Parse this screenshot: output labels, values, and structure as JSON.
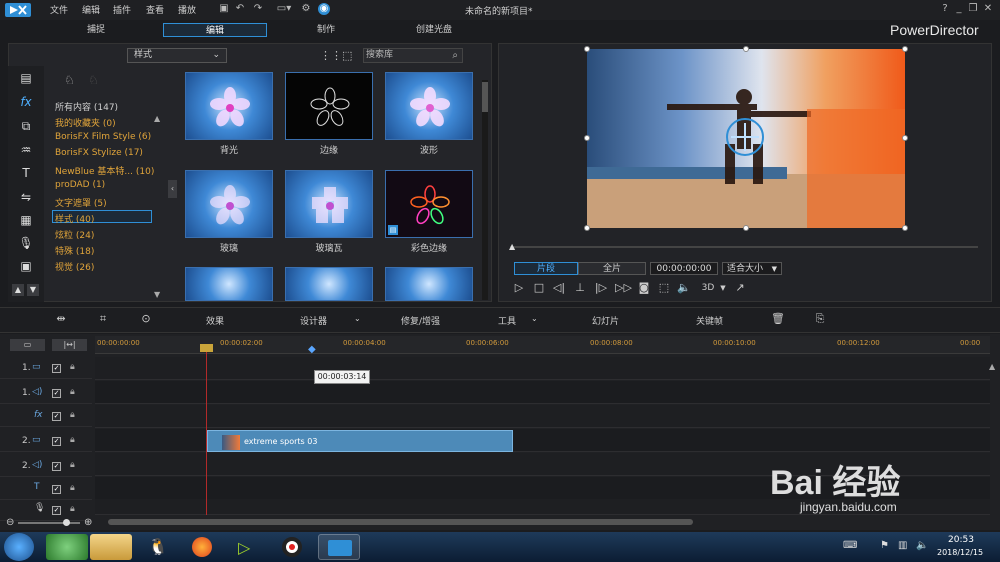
{
  "titlebar": {
    "menus": [
      "文件",
      "编辑",
      "插件",
      "查看",
      "播放"
    ],
    "doc_title": "未命名的新项目*",
    "brand": "PowerDirector",
    "window_controls": [
      "?",
      "_",
      "❐",
      "✕"
    ]
  },
  "mode_tabs": [
    "捕捉",
    "编辑",
    "制作",
    "创建光盘"
  ],
  "library": {
    "style_select": "样式",
    "search_placeholder": "搜索库",
    "categories": [
      "所有内容 (147)",
      "我的收藏夹 (0)",
      "BorisFX Film Style (6)",
      "BorisFX Stylize (17)",
      "NewBlue 基本特... (10)",
      "proDAD (1)",
      "文字遮罩 (5)",
      "样式 (40)",
      "炫粒 (24)",
      "特殊 (18)",
      "视觉 (26)"
    ],
    "thumbnails": [
      "背光",
      "边缘",
      "波形",
      "玻璃",
      "玻璃瓦",
      "彩色边缘"
    ]
  },
  "preview": {
    "clip_button": "片段",
    "full_button": "全片",
    "timecode": "00:00:00:00",
    "fit_select": "适合大小",
    "three_d": "3D"
  },
  "edit_toolbar": {
    "effects": "效果",
    "designer": "设计器",
    "fix_enhance": "修复/增强",
    "tools": "工具",
    "slideshow": "幻灯片",
    "keyframe": "关键帧"
  },
  "timeline": {
    "ruler_ticks": [
      "00:00:00:00",
      "00:00:02:00",
      "00:00:04:00",
      "00:00:06:00",
      "00:00:08:00",
      "00:00:10:00",
      "00:00:12:00",
      "00:00"
    ],
    "tooltip": "00:00:03:14",
    "tracks": [
      "1.",
      "1.",
      "",
      "2.",
      "2.",
      "",
      ""
    ],
    "clip_name": "extreme sports 03"
  },
  "taskbar": {
    "time": "20:53",
    "date": "2018/12/15"
  },
  "watermark": {
    "main": "Bai 经验",
    "sub": "jingyan.baidu.com"
  }
}
